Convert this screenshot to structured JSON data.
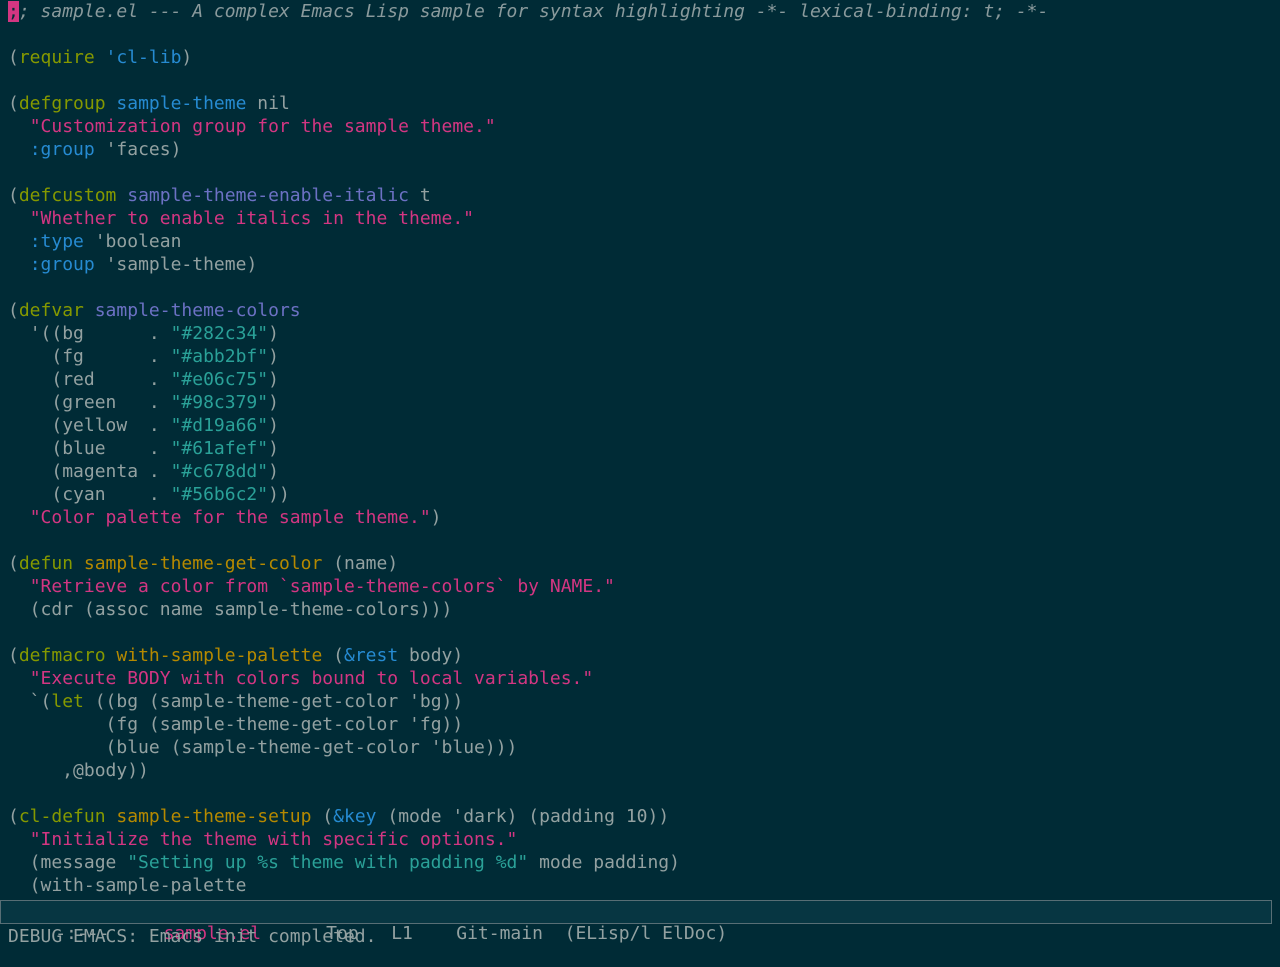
{
  "buffer": {
    "lines": [
      ";; sample.el --- A complex Emacs Lisp sample for syntax highlighting -*- lexical-binding: t; -*-",
      "",
      "(require 'cl-lib)",
      "",
      "(defgroup sample-theme nil",
      "  \"Customization group for the sample theme.\"",
      "  :group 'faces)",
      "",
      "(defcustom sample-theme-enable-italic t",
      "  \"Whether to enable italics in the theme.\"",
      "  :type 'boolean",
      "  :group 'sample-theme)",
      "",
      "(defvar sample-theme-colors",
      "  '((bg      . \"#282c34\")",
      "    (fg      . \"#abb2bf\")",
      "    (red     . \"#e06c75\")",
      "    (green   . \"#98c379\")",
      "    (yellow  . \"#d19a66\")",
      "    (blue    . \"#61afef\")",
      "    (magenta . \"#c678dd\")",
      "    (cyan    . \"#56b6c2\"))",
      "  \"Color palette for the sample theme.\")",
      "",
      "(defun sample-theme-get-color (name)",
      "  \"Retrieve a color from `sample-theme-colors` by NAME.\"",
      "  (cdr (assoc name sample-theme-colors)))",
      "",
      "(defmacro with-sample-palette (&rest body)",
      "  \"Execute BODY with colors bound to local variables.\"",
      "  `(let ((bg (sample-theme-get-color 'bg))",
      "         (fg (sample-theme-get-color 'fg))",
      "         (blue (sample-theme-get-color 'blue)))",
      "     ,@body))",
      "",
      "(cl-defun sample-theme-setup (&key (mode 'dark) (padding 10))",
      "  \"Initialize the theme with specific options.\"",
      "  (message \"Setting up %s theme with padding %d\" mode padding)",
      "  (with-sample-palette"
    ]
  },
  "modeline": {
    "status": " -:---  ",
    "buffer_name": "sample.el",
    "position": "Top",
    "line": "L1",
    "vcs": "Git-main",
    "modes": "(ELisp/l ElDoc)"
  },
  "echo_area": {
    "message": "DEBUG EMACS: Emacs init completed."
  },
  "colors": {
    "background": "#002b36",
    "comment": "#8a9a9c",
    "keyword": "#859900",
    "function": "#b58900",
    "variable": "#6c71c4",
    "symbol": "#268bd2",
    "string": "#d33682",
    "hex_string": "#2aa198",
    "cursor": "#d33682"
  }
}
